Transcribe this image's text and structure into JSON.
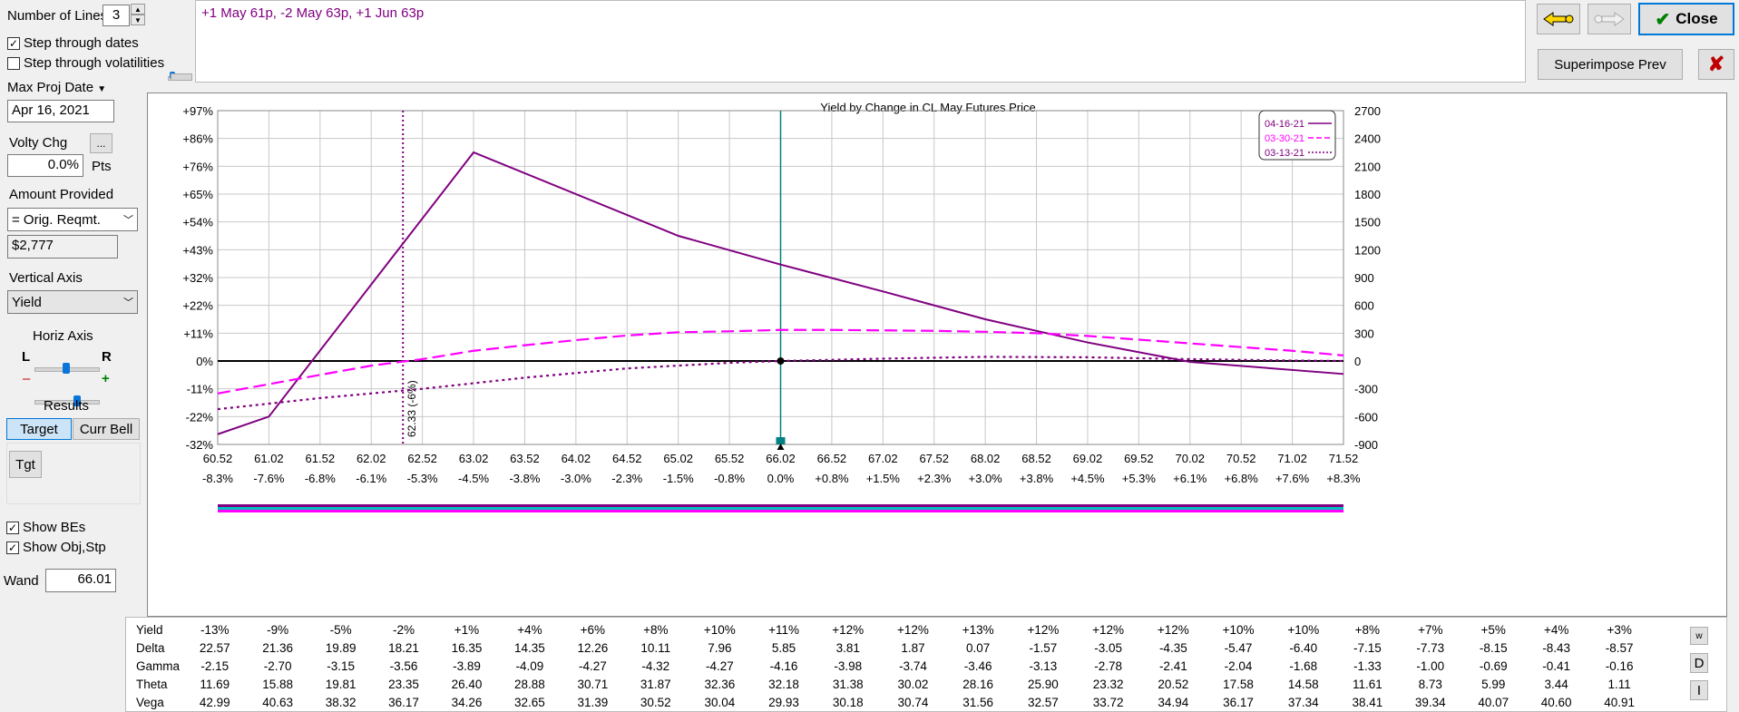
{
  "controls": {
    "num_lines_label": "Number of Lines",
    "num_lines_value": "3",
    "step_dates_label": "Step through dates",
    "step_dates_checked": true,
    "step_vol_label": "Step through volatilities",
    "step_vol_checked": false,
    "max_proj_date_label": "Max Proj Date",
    "max_proj_date_value": "Apr 16, 2021",
    "volty_chg_label": "Volty Chg",
    "volty_more_label": "...",
    "volty_chg_value": "0.0%",
    "pts_label": "Pts",
    "amount_provided_label": "Amount Provided",
    "amount_provided_value": "= Orig. Reqmt.",
    "amount_value": "$2,777",
    "vertical_axis_label": "Vertical Axis",
    "vertical_axis_value": "Yield",
    "horiz_axis_label": "Horiz Axis",
    "horiz_l": "L",
    "horiz_r": "R",
    "zoom_minus": "–",
    "zoom_plus": "+",
    "results_label": "Results",
    "target_tab": "Target",
    "curr_bell_tab": "Curr Bell",
    "tgt_button": "Tgt",
    "show_bes_label": "Show BEs",
    "show_bes_checked": true,
    "show_obj_label": "Show Obj,Stp",
    "show_obj_checked": true,
    "wand_label": "Wand",
    "wand_value": "66.01"
  },
  "position_text": "+1 May 61p, -2 May 63p, +1 Jun 63p",
  "buttons": {
    "close": "Close",
    "superimpose": "Superimpose Prev"
  },
  "colors": {
    "series1": "#800080",
    "series2": "#ff00ff",
    "series3": "#800080",
    "wand_line": "#008080",
    "arrow_back": "#ffd700"
  },
  "chart_data": {
    "type": "line",
    "title": "Yield by Change in CL May Futures Price",
    "x_ticks": [
      "60.52",
      "61.02",
      "61.52",
      "62.02",
      "62.52",
      "63.02",
      "63.52",
      "64.02",
      "64.52",
      "65.02",
      "65.52",
      "66.02",
      "66.52",
      "67.02",
      "67.52",
      "68.02",
      "68.52",
      "69.02",
      "69.52",
      "70.02",
      "70.52",
      "71.02",
      "71.52"
    ],
    "x_pct_ticks": [
      "-8.3%",
      "-7.6%",
      "-6.8%",
      "-6.1%",
      "-5.3%",
      "-4.5%",
      "-3.8%",
      "-3.0%",
      "-2.3%",
      "-1.5%",
      "-0.8%",
      "0.0%",
      "+0.8%",
      "+1.5%",
      "+2.3%",
      "+3.0%",
      "+3.8%",
      "+4.5%",
      "+5.3%",
      "+6.1%",
      "+6.8%",
      "+7.6%",
      "+8.3%"
    ],
    "xlim": [
      60.52,
      71.52
    ],
    "y_left_ticks": [
      "+97%",
      "+86%",
      "+76%",
      "+65%",
      "+54%",
      "+43%",
      "+32%",
      "+22%",
      "+11%",
      "0%",
      "-11%",
      "-22%",
      "-32%"
    ],
    "y_right_ticks": [
      "2700",
      "2400",
      "2100",
      "1800",
      "1500",
      "1200",
      "900",
      "600",
      "300",
      "0",
      "-300",
      "-600",
      "-900"
    ],
    "ylim": [
      -900,
      2700
    ],
    "series": [
      {
        "name": "04-16-21",
        "style": "solid",
        "x": [
          60.52,
          61.02,
          63.02,
          65.02,
          66.02,
          67.02,
          68.02,
          69.02,
          70.02,
          71.52
        ],
        "y": [
          -790,
          -600,
          2250,
          1350,
          1040,
          750,
          450,
          200,
          -10,
          -140
        ]
      },
      {
        "name": "03-30-21",
        "style": "dashed",
        "x": [
          60.52,
          61.02,
          61.52,
          62.02,
          62.52,
          63.02,
          63.52,
          64.02,
          64.52,
          65.02,
          65.52,
          66.02,
          66.52,
          67.02,
          67.52,
          68.02,
          68.52,
          69.02,
          69.52,
          70.02,
          70.52,
          71.02,
          71.52
        ],
        "y": [
          -350,
          -250,
          -150,
          -50,
          20,
          110,
          170,
          225,
          275,
          310,
          320,
          335,
          335,
          330,
          325,
          315,
          300,
          270,
          230,
          190,
          150,
          110,
          60
        ]
      },
      {
        "name": "03-13-21",
        "style": "dotted",
        "x": [
          60.52,
          61.52,
          62.52,
          63.52,
          64.52,
          65.52,
          66.02,
          67.02,
          68.02,
          69.02,
          70.02,
          71.02,
          71.52
        ],
        "y": [
          -520,
          -400,
          -300,
          -180,
          -80,
          -20,
          0,
          25,
          45,
          40,
          20,
          5,
          0
        ]
      }
    ],
    "wand": 66.02,
    "breakeven": {
      "x": 62.33,
      "label": "62.33 (-6%)"
    },
    "legend_position": "top-right",
    "grid": true
  },
  "table": {
    "rows": [
      {
        "label": "Yield",
        "values": [
          "-13%",
          "-9%",
          "-5%",
          "-2%",
          "+1%",
          "+4%",
          "+6%",
          "+8%",
          "+10%",
          "+11%",
          "+12%",
          "+12%",
          "+13%",
          "+12%",
          "+12%",
          "+12%",
          "+10%",
          "+10%",
          "+8%",
          "+7%",
          "+5%",
          "+4%",
          "+3%"
        ]
      },
      {
        "label": "Delta",
        "values": [
          "22.57",
          "21.36",
          "19.89",
          "18.21",
          "16.35",
          "14.35",
          "12.26",
          "10.11",
          "7.96",
          "5.85",
          "3.81",
          "1.87",
          "0.07",
          "-1.57",
          "-3.05",
          "-4.35",
          "-5.47",
          "-6.40",
          "-7.15",
          "-7.73",
          "-8.15",
          "-8.43",
          "-8.57"
        ]
      },
      {
        "label": "Gamma",
        "values": [
          "-2.15",
          "-2.70",
          "-3.15",
          "-3.56",
          "-3.89",
          "-4.09",
          "-4.27",
          "-4.32",
          "-4.27",
          "-4.16",
          "-3.98",
          "-3.74",
          "-3.46",
          "-3.13",
          "-2.78",
          "-2.41",
          "-2.04",
          "-1.68",
          "-1.33",
          "-1.00",
          "-0.69",
          "-0.41",
          "-0.16"
        ]
      },
      {
        "label": "Theta",
        "values": [
          "11.69",
          "15.88",
          "19.81",
          "23.35",
          "26.40",
          "28.88",
          "30.71",
          "31.87",
          "32.36",
          "32.18",
          "31.38",
          "30.02",
          "28.16",
          "25.90",
          "23.32",
          "20.52",
          "17.58",
          "14.58",
          "11.61",
          "8.73",
          "5.99",
          "3.44",
          "1.11"
        ]
      },
      {
        "label": "Vega",
        "values": [
          "42.99",
          "40.63",
          "38.32",
          "36.17",
          "34.26",
          "32.65",
          "31.39",
          "30.52",
          "30.04",
          "29.93",
          "30.18",
          "30.74",
          "31.56",
          "32.57",
          "33.72",
          "34.94",
          "36.17",
          "37.34",
          "38.41",
          "39.34",
          "40.07",
          "40.60",
          "40.91"
        ]
      }
    ]
  },
  "side_buttons": {
    "w": "w",
    "d": "D",
    "i": "I"
  }
}
